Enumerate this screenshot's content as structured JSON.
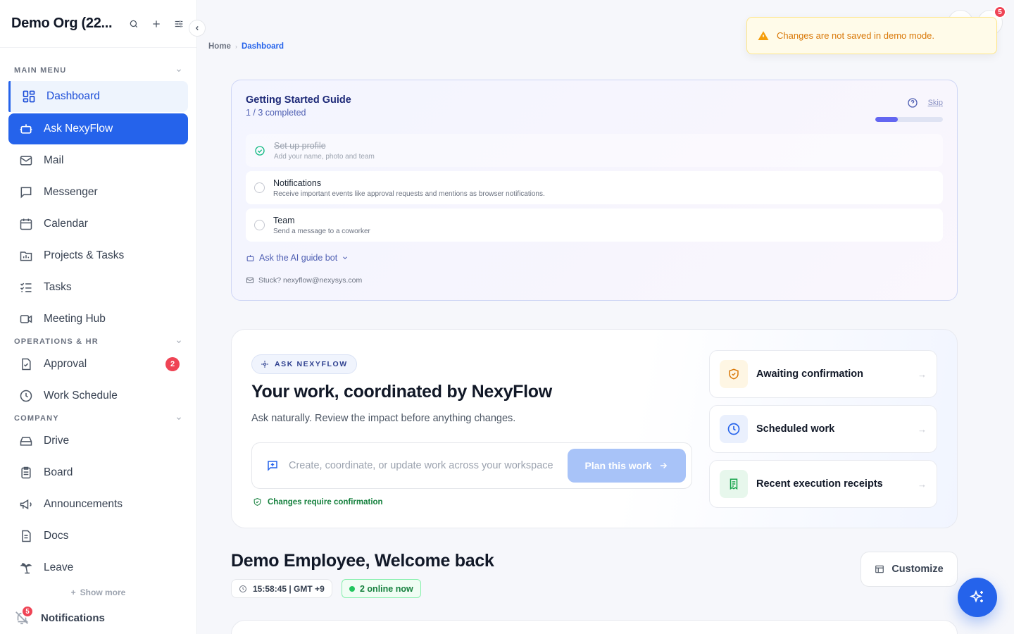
{
  "org": {
    "title": "Demo Org (22..."
  },
  "sidebar": {
    "sections": [
      {
        "label": "MAIN MENU"
      },
      {
        "label": "OPERATIONS & HR"
      },
      {
        "label": "COMPANY"
      }
    ],
    "main_items": [
      {
        "label": "Dashboard",
        "icon": "dashboard-icon"
      },
      {
        "label": "Ask NexyFlow",
        "icon": "bot-icon"
      },
      {
        "label": "Mail",
        "icon": "mail-icon"
      },
      {
        "label": "Messenger",
        "icon": "message-icon"
      },
      {
        "label": "Calendar",
        "icon": "calendar-icon"
      },
      {
        "label": "Projects & Tasks",
        "icon": "folder-chart-icon"
      },
      {
        "label": "Tasks",
        "icon": "checklist-icon"
      },
      {
        "label": "Meeting Hub",
        "icon": "video-icon"
      }
    ],
    "ops_items": [
      {
        "label": "Approval",
        "icon": "file-check-icon",
        "badge": "2"
      },
      {
        "label": "Work Schedule",
        "icon": "clock-icon"
      }
    ],
    "company_items": [
      {
        "label": "Drive",
        "icon": "drive-icon"
      },
      {
        "label": "Board",
        "icon": "clipboard-icon"
      },
      {
        "label": "Announcements",
        "icon": "megaphone-icon"
      },
      {
        "label": "Docs",
        "icon": "doc-icon"
      },
      {
        "label": "Leave",
        "icon": "palm-icon"
      }
    ],
    "show_more": "Show more",
    "notifications": {
      "label": "Notifications",
      "badge": "5"
    }
  },
  "breadcrumb": {
    "home": "Home",
    "current": "Dashboard"
  },
  "toast": {
    "message": "Changes are not saved in demo mode."
  },
  "top_badge": "5",
  "guide": {
    "title": "Getting Started Guide",
    "progress_text": "1 / 3 completed",
    "progress_fraction": 0.333,
    "skip": "Skip",
    "steps": [
      {
        "title": "Set up profile",
        "desc": "Add your name, photo and team",
        "done": true
      },
      {
        "title": "Notifications",
        "desc": "Receive important events like approval requests and mentions as browser notifications.",
        "done": false
      },
      {
        "title": "Team",
        "desc": "Send a message to a coworker",
        "done": false
      }
    ],
    "ai_bot": "Ask the AI guide bot",
    "stuck": "Stuck? nexyflow@nexysys.com"
  },
  "hero": {
    "pill": "ASK NEXYFLOW",
    "title": "Your work, coordinated by NexyFlow",
    "lead": "Ask naturally. Review the impact before anything changes.",
    "input_placeholder": "Create, coordinate, or update work across your workspace",
    "plan_button": "Plan this work",
    "confirm_note": "Changes require confirmation",
    "cards": [
      {
        "label": "Awaiting confirmation",
        "icon": "shield-check-icon",
        "color": "#f59e0b"
      },
      {
        "label": "Scheduled work",
        "icon": "clock-icon",
        "color": "#2563eb"
      },
      {
        "label": "Recent execution receipts",
        "icon": "receipt-icon",
        "color": "#16a34a"
      }
    ]
  },
  "welcome": {
    "title": "Demo Employee, Welcome back",
    "clock": "15:58:45 | GMT +9",
    "online": "2 online now",
    "customize": "Customize"
  }
}
